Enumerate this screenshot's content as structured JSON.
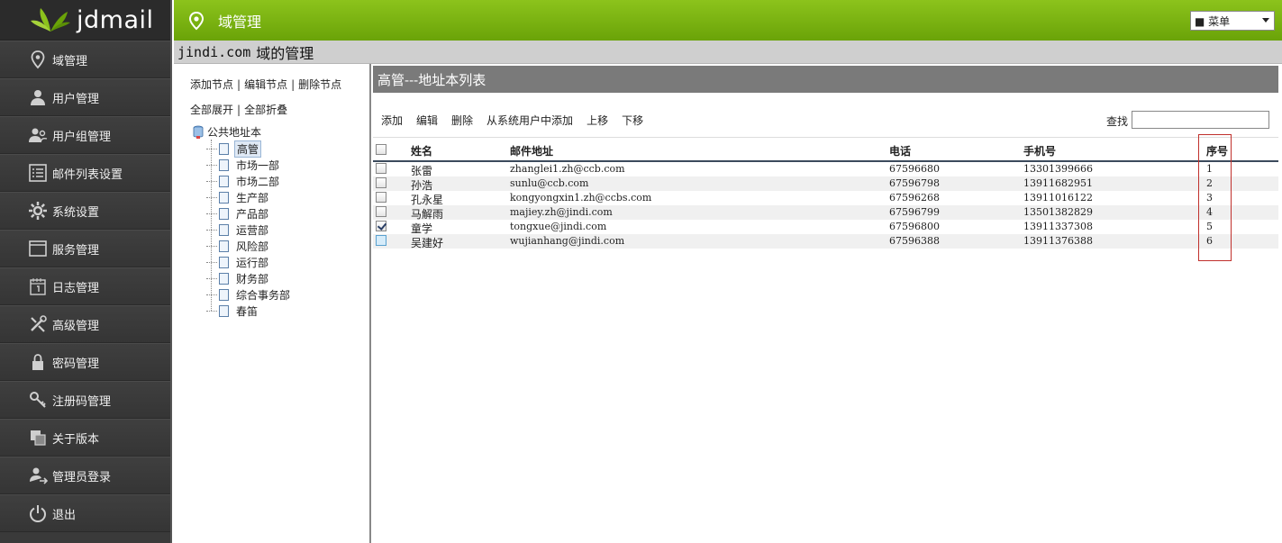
{
  "app": {
    "brand": "jdmail",
    "section_title": "域管理",
    "menu_select": "■ 菜单"
  },
  "sidebar": {
    "items": [
      {
        "label": "域管理",
        "icon": "location-pin-icon"
      },
      {
        "label": "用户管理",
        "icon": "user-icon"
      },
      {
        "label": "用户组管理",
        "icon": "user-group-icon"
      },
      {
        "label": "邮件列表设置",
        "icon": "list-icon"
      },
      {
        "label": "系统设置",
        "icon": "gear-icon"
      },
      {
        "label": "服务管理",
        "icon": "window-icon"
      },
      {
        "label": "日志管理",
        "icon": "calendar-icon"
      },
      {
        "label": "高级管理",
        "icon": "tools-icon"
      },
      {
        "label": "密码管理",
        "icon": "lock-icon"
      },
      {
        "label": "注册码管理",
        "icon": "key-icon"
      },
      {
        "label": "关于版本",
        "icon": "copy-icon"
      },
      {
        "label": "管理员登录",
        "icon": "admin-login-icon"
      },
      {
        "label": "退出",
        "icon": "power-icon"
      }
    ]
  },
  "subheader": {
    "domain": "jindi.com",
    "suffix": "域的管理"
  },
  "tree": {
    "actions_row1": [
      "添加节点",
      "编辑节点",
      "删除节点"
    ],
    "actions_row2": [
      "全部展开",
      "全部折叠"
    ],
    "root": "公共地址本",
    "nodes": [
      "高管",
      "市场一部",
      "市场二部",
      "生产部",
      "产品部",
      "运营部",
      "风险部",
      "运行部",
      "财务部",
      "综合事务部",
      "春笛"
    ],
    "selected_index": 0
  },
  "list": {
    "title": "高管---地址本列表",
    "toolbar": [
      "添加",
      "编辑",
      "删除",
      "从系统用户中添加",
      "上移",
      "下移"
    ],
    "search_label": "查找",
    "search_placeholder": "",
    "columns": [
      "姓名",
      "邮件地址",
      "电话",
      "手机号",
      "序号"
    ],
    "rows": [
      {
        "name": "张雷",
        "email": "zhanglei1.zh@ccb.com",
        "phone": "67596680",
        "mobile": "13301399666",
        "seq": "1",
        "checked": false
      },
      {
        "name": "孙浩",
        "email": "sunlu@ccb.com",
        "phone": "67596798",
        "mobile": "13911682951",
        "seq": "2",
        "checked": false
      },
      {
        "name": "孔永星",
        "email": "kongyongxin1.zh@ccbs.com",
        "phone": "67596268",
        "mobile": "13911016122",
        "seq": "3",
        "checked": false
      },
      {
        "name": "马解雨",
        "email": "majiey.zh@jindi.com",
        "phone": "67596799",
        "mobile": "13501382829",
        "seq": "4",
        "checked": false
      },
      {
        "name": "童学",
        "email": "tongxue@jindi.com",
        "phone": "67596800",
        "mobile": "13911337308",
        "seq": "5",
        "checked": true
      },
      {
        "name": "吴建好",
        "email": "wujianhang@jindi.com",
        "phone": "67596388",
        "mobile": "13911376388",
        "seq": "6",
        "checked": false
      }
    ]
  },
  "colors": {
    "topbar_green": "#7ab312",
    "sidebar_bg": "#3a3a3a",
    "highlight_red": "#c0302c"
  }
}
